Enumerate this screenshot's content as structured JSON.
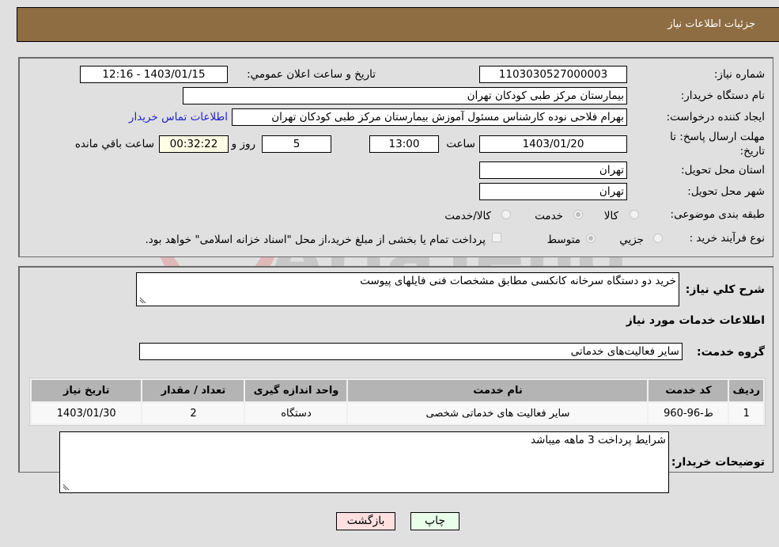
{
  "header": {
    "title": "جزئیات اطلاعات نیاز"
  },
  "fields": {
    "need_number_label": "شماره نیاز:",
    "need_number": "1103030527000003",
    "announce_label": "تاریخ و ساعت اعلان عمومي:",
    "announce_value": "1403/01/15 - 12:16",
    "buyer_org_label": "نام دستگاه خریدار:",
    "buyer_org": "بیمارستان مرکز طبی کودکان تهران",
    "creator_label": "ایجاد کننده درخواست:",
    "creator": "بهرام فلاحی نوده کارشناس مسئول آموزش بیمارستان مرکز طبی کودکان تهران",
    "contact_link": "اطلاعات تماس خریدار",
    "deadline_label": "مهلت ارسال پاسخ: تا تاریخ:",
    "deadline_date": "1403/01/20",
    "time_label": "ساعت",
    "deadline_time": "13:00",
    "days_value": "5",
    "days_label": "روز و",
    "remaining_time": "00:32:22",
    "remaining_label": "ساعت باقي مانده",
    "province_label": "استان محل تحویل:",
    "province": "تهران",
    "city_label": "شهر محل تحویل:",
    "city": "تهران",
    "category_label": "طبقه بندی موضوعی:",
    "category_options": [
      {
        "label": "کالا",
        "checked": false
      },
      {
        "label": "خدمت",
        "checked": true
      },
      {
        "label": "کالا/خدمت",
        "checked": false
      }
    ],
    "process_label": "نوع فرآیند خرید :",
    "process_options": [
      {
        "label": "جزيي",
        "checked": false
      },
      {
        "label": "متوسط",
        "checked": true
      }
    ],
    "treasury_note": "پرداخت تمام یا بخشی از مبلغ خرید،از محل \"اسناد خزانه اسلامی\" خواهد بود."
  },
  "details": {
    "description_label": "شرح کلي نیاز:",
    "description": "خرید دو دستگاه سرخانه کانکسی مطابق مشخصات فنی فایلهای پیوست",
    "services_heading": "اطلاعات خدمات مورد نیاز",
    "service_group_label": "گروه خدمت:",
    "service_group": "سایر فعالیت‌های خدماتی",
    "table": {
      "headers": [
        "ردیف",
        "کد خدمت",
        "نام خدمت",
        "واحد اندازه گیری",
        "تعداد / مقدار",
        "تاریخ نیاز"
      ],
      "rows": [
        [
          "1",
          "ط-96-960",
          "سایر فعالیت های خدماتی شخصی",
          "دستگاه",
          "2",
          "1403/01/30"
        ]
      ]
    },
    "buyer_notes_label": "توضیحات خریدار:",
    "buyer_notes": "شرایط پرداخت 3 ماهه میباشد"
  },
  "buttons": {
    "print": "چاپ",
    "back": "بازگشت"
  },
  "watermark": {
    "text": "AriaTender.neT"
  },
  "colors": {
    "header_bg": "#8e6d42",
    "print_bg": "#eaffea",
    "back_bg": "#ffe0e0",
    "link": "#2222cc"
  }
}
